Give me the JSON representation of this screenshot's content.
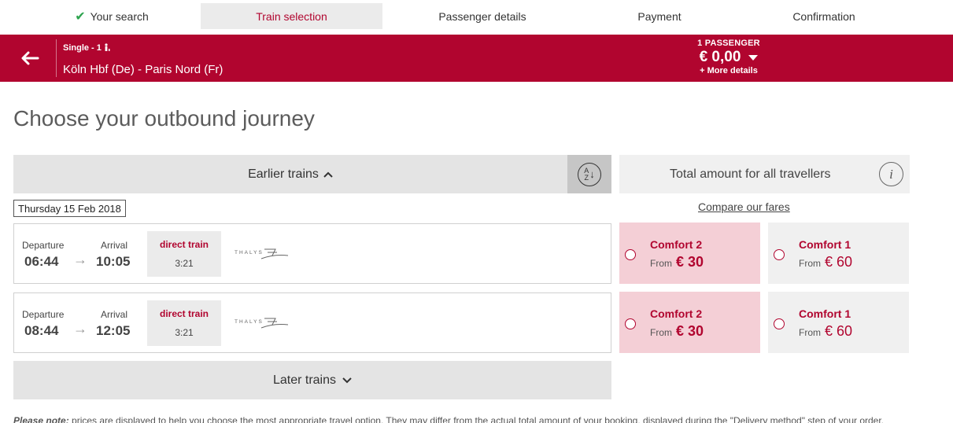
{
  "steps": [
    {
      "label": "Your search",
      "done": true
    },
    {
      "label": "Train selection",
      "active": true
    },
    {
      "label": "Passenger details"
    },
    {
      "label": "Payment"
    },
    {
      "label": "Confirmation"
    }
  ],
  "header": {
    "ticket_type": "Single - 1",
    "route": "Köln Hbf (De) - Paris Nord (Fr)",
    "passengers": "1 PASSENGER",
    "total_price": "€ 0,00",
    "more_details": "+ More details"
  },
  "page_title": "Choose your outbound journey",
  "earlier_label": "Earlier trains",
  "later_label": "Later trains",
  "sort_glyph_top": "A",
  "sort_glyph_bottom": "Z",
  "total_label": "Total amount for all travellers",
  "info_glyph": "i",
  "date": "Thursday 15 Feb 2018",
  "compare_link": "Compare our fares",
  "trains": [
    {
      "departure_label": "Departure",
      "departure": "06:44",
      "arrival_label": "Arrival",
      "arrival": "10:05",
      "type": "direct train",
      "duration": "3:21",
      "operator": "THALYS",
      "fares": [
        {
          "name": "Comfort 2",
          "from": "From",
          "price": "€ 30"
        },
        {
          "name": "Comfort 1",
          "from": "From",
          "price": "€ 60"
        }
      ]
    },
    {
      "departure_label": "Departure",
      "departure": "08:44",
      "arrival_label": "Arrival",
      "arrival": "12:05",
      "type": "direct train",
      "duration": "3:21",
      "operator": "THALYS",
      "fares": [
        {
          "name": "Comfort 2",
          "from": "From",
          "price": "€ 30"
        },
        {
          "name": "Comfort 1",
          "from": "From",
          "price": "€ 60"
        }
      ]
    }
  ],
  "note_bold": "Please note:",
  "note_text": " prices are displayed to help you choose the most appropriate travel option. They may differ from the actual total amount of your booking, displayed during the \"Delivery method\" step of your order."
}
